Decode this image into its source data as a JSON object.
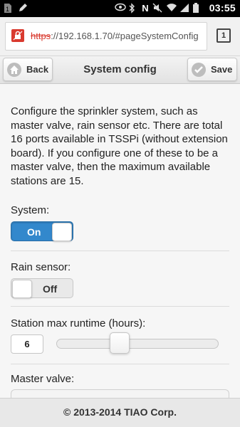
{
  "status_bar": {
    "time": "03:55",
    "notification_icons": [
      "sim-icon",
      "edit-icon"
    ],
    "system_icons": [
      "eye-icon",
      "bluetooth-icon",
      "nfc-icon",
      "mute-icon",
      "wifi-icon",
      "signal-icon",
      "battery-icon"
    ]
  },
  "browser": {
    "url_scheme": "https",
    "url_rest": "://192.168.1.70/#pageSystemConfig",
    "tab_count": "1"
  },
  "header": {
    "back_label": "Back",
    "title": "System config",
    "save_label": "Save"
  },
  "intro_text": "Configure the sprinkler system, such as master valve, rain sensor etc. There are total 16 ports available in TSSPi (without extension board). If you configure one of these to be a master valve, then the maximum available stations are 15.",
  "system": {
    "label": "System:",
    "state": "On",
    "on": true
  },
  "rain_sensor": {
    "label": "Rain sensor:",
    "state": "Off",
    "on": false
  },
  "runtime": {
    "label": "Station max runtime (hours):",
    "value": "6",
    "slider_fraction": 0.39
  },
  "master_valve": {
    "label": "Master valve:"
  },
  "footer": {
    "text": "© 2013-2014 TIAO Corp."
  },
  "colors": {
    "accent": "#3388cc",
    "https_strike": "#d93a2f"
  }
}
